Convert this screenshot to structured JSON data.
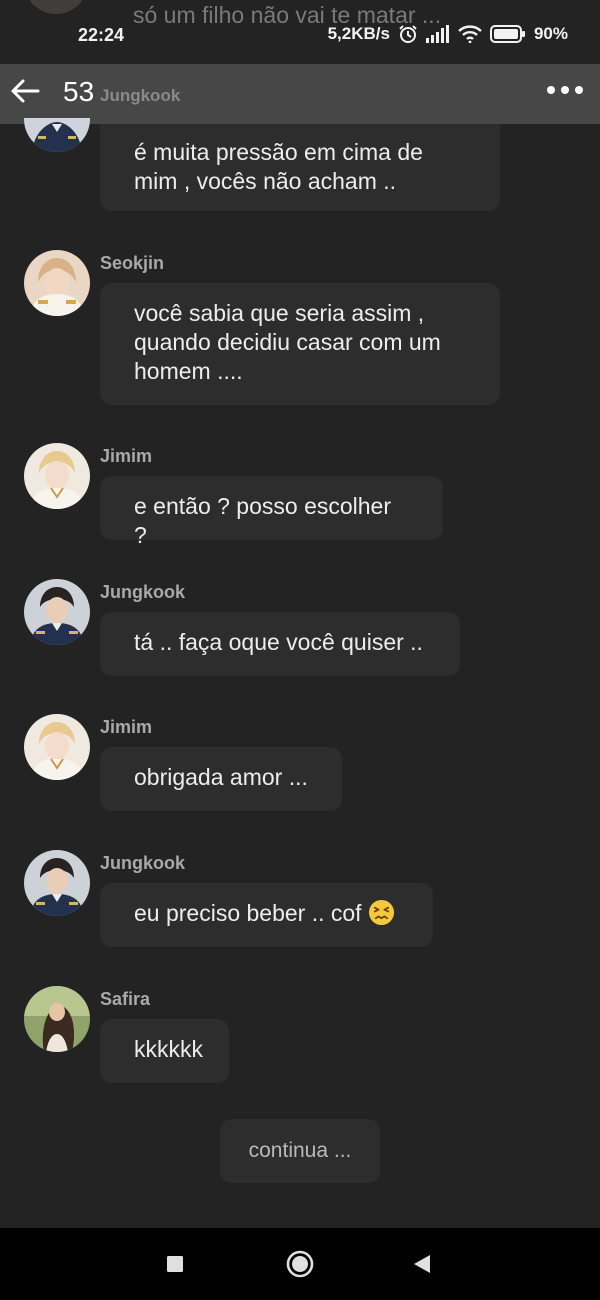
{
  "status": {
    "time": "22:24",
    "speed": "5,2KB/s",
    "battery": "90%"
  },
  "header": {
    "title": "53"
  },
  "ghost": {
    "text": "só um filho não vai te matar ...",
    "author": "Jungkook"
  },
  "messages": [
    {
      "author": "",
      "lines": [
        "é muita pressão em cima de",
        "mim , vocês não acham .."
      ]
    },
    {
      "author": "Seokjin",
      "lines": [
        "você sabia que seria assim ,",
        "quando decidiu casar com um",
        "homem ...."
      ]
    },
    {
      "author": "Jimim",
      "lines": [
        "e então ? posso escolher ?"
      ]
    },
    {
      "author": "Jungkook",
      "lines": [
        "tá .. faça oque você quiser .."
      ]
    },
    {
      "author": "Jimim",
      "lines": [
        "obrigada amor ..."
      ]
    },
    {
      "author": "Jungkook",
      "lines": [
        "eu preciso beber .. cof"
      ]
    },
    {
      "author": "Safira",
      "lines": [
        "kkkkkk"
      ]
    }
  ],
  "continue_label": "continua ...",
  "icons": {
    "back": "arrow-left-icon",
    "more": "more-dots-icon",
    "alarm": "alarm-icon",
    "signal": "signal-icon",
    "wifi": "wifi-icon",
    "battery": "battery-icon",
    "emoji": "confounded-face-emoji",
    "nav_recent": "square-icon",
    "nav_home": "circle-icon",
    "nav_back": "triangle-back-icon"
  },
  "colors": {
    "background": "#232323",
    "bubble": "#2d2d2d",
    "header": "#4a4a4a",
    "author": "#a9a9a9"
  }
}
